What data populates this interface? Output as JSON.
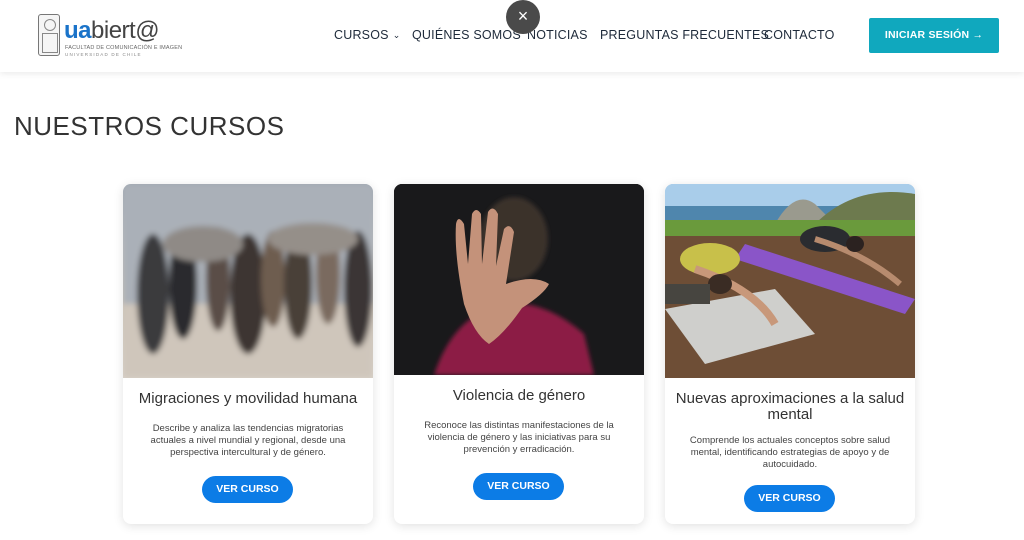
{
  "header": {
    "logo": {
      "brand_ua": "ua",
      "brand_rest": "biert@",
      "subtitle1": "FACULTAD DE COMUNICACIÓN E IMAGEN",
      "subtitle2": "UNIVERSIDAD DE CHILE"
    },
    "nav": [
      {
        "label": "CURSOS",
        "has_dropdown": true
      },
      {
        "label": "QUIÉNES SOMOS"
      },
      {
        "label": "NOTICIAS"
      },
      {
        "label": "PREGUNTAS FRECUENTES"
      },
      {
        "label": "CONTACTO"
      }
    ],
    "close_glyph": "×",
    "login_button": "INICIAR SESIÓN →"
  },
  "page_title": "NUESTROS CURSOS",
  "courses": [
    {
      "title": "Migraciones y movilidad humana",
      "description": "Describe y analiza las tendencias migratorias actuales a nivel mundial y regional, desde una perspectiva intercultural y de género.",
      "button": "VER CURSO",
      "image": "crowd-photo"
    },
    {
      "title": "Violencia de género",
      "description": "Reconoce las distintas manifestaciones de la violencia de género y las iniciativas para su prevención y erradicación.",
      "button": "VER CURSO",
      "image": "hand-stop-photo"
    },
    {
      "title": "Nuevas aproximaciones a la salud mental",
      "description": "Comprende los actuales conceptos sobre salud mental, identificando estrategias de apoyo y de autocuidado.",
      "button": "VER CURSO",
      "image": "yoga-photo"
    }
  ],
  "colors": {
    "accent_teal": "#10a8be",
    "button_blue": "#0c7ce6",
    "brand_blue": "#1a73c9"
  }
}
